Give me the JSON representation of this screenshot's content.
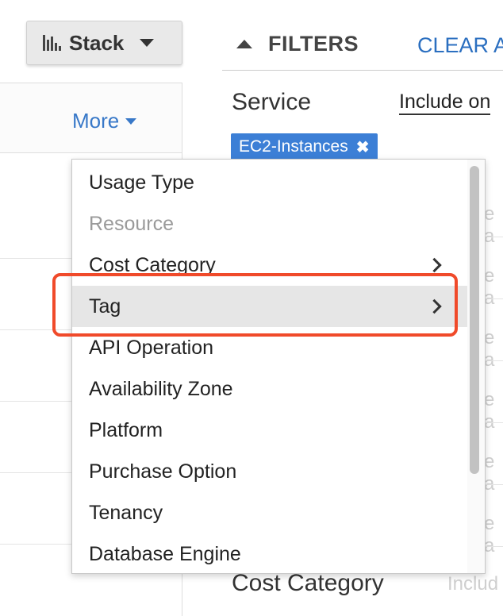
{
  "toolbar": {
    "stack_label": "Stack"
  },
  "left_panel": {
    "more_label": "More"
  },
  "filters": {
    "title": "FILTERS",
    "clear_label": "CLEAR A",
    "service_label": "Service",
    "include_label": "Include on",
    "chip_label": "EC2-Instances",
    "chip_remove": "✖",
    "cost_category_label": "Cost Category",
    "cost_category_include": "Includ",
    "ghost_char": "e a"
  },
  "dropdown": {
    "items": [
      {
        "label": "Usage Type",
        "disabled": false,
        "submenu": false
      },
      {
        "label": "Resource",
        "disabled": true,
        "submenu": false
      },
      {
        "label": "Cost Category",
        "disabled": false,
        "submenu": true
      },
      {
        "label": "Tag",
        "disabled": false,
        "submenu": true,
        "highlighted": true
      },
      {
        "label": "API Operation",
        "disabled": false,
        "submenu": false
      },
      {
        "label": "Availability Zone",
        "disabled": false,
        "submenu": false
      },
      {
        "label": "Platform",
        "disabled": false,
        "submenu": false
      },
      {
        "label": "Purchase Option",
        "disabled": false,
        "submenu": false
      },
      {
        "label": "Tenancy",
        "disabled": false,
        "submenu": false
      },
      {
        "label": "Database Engine",
        "disabled": false,
        "submenu": false
      }
    ]
  },
  "colors": {
    "link_blue": "#3878c8",
    "chip_blue": "#3c7fd6",
    "highlight_red": "#f04a2a",
    "hover_gray": "#e6e6e6"
  }
}
